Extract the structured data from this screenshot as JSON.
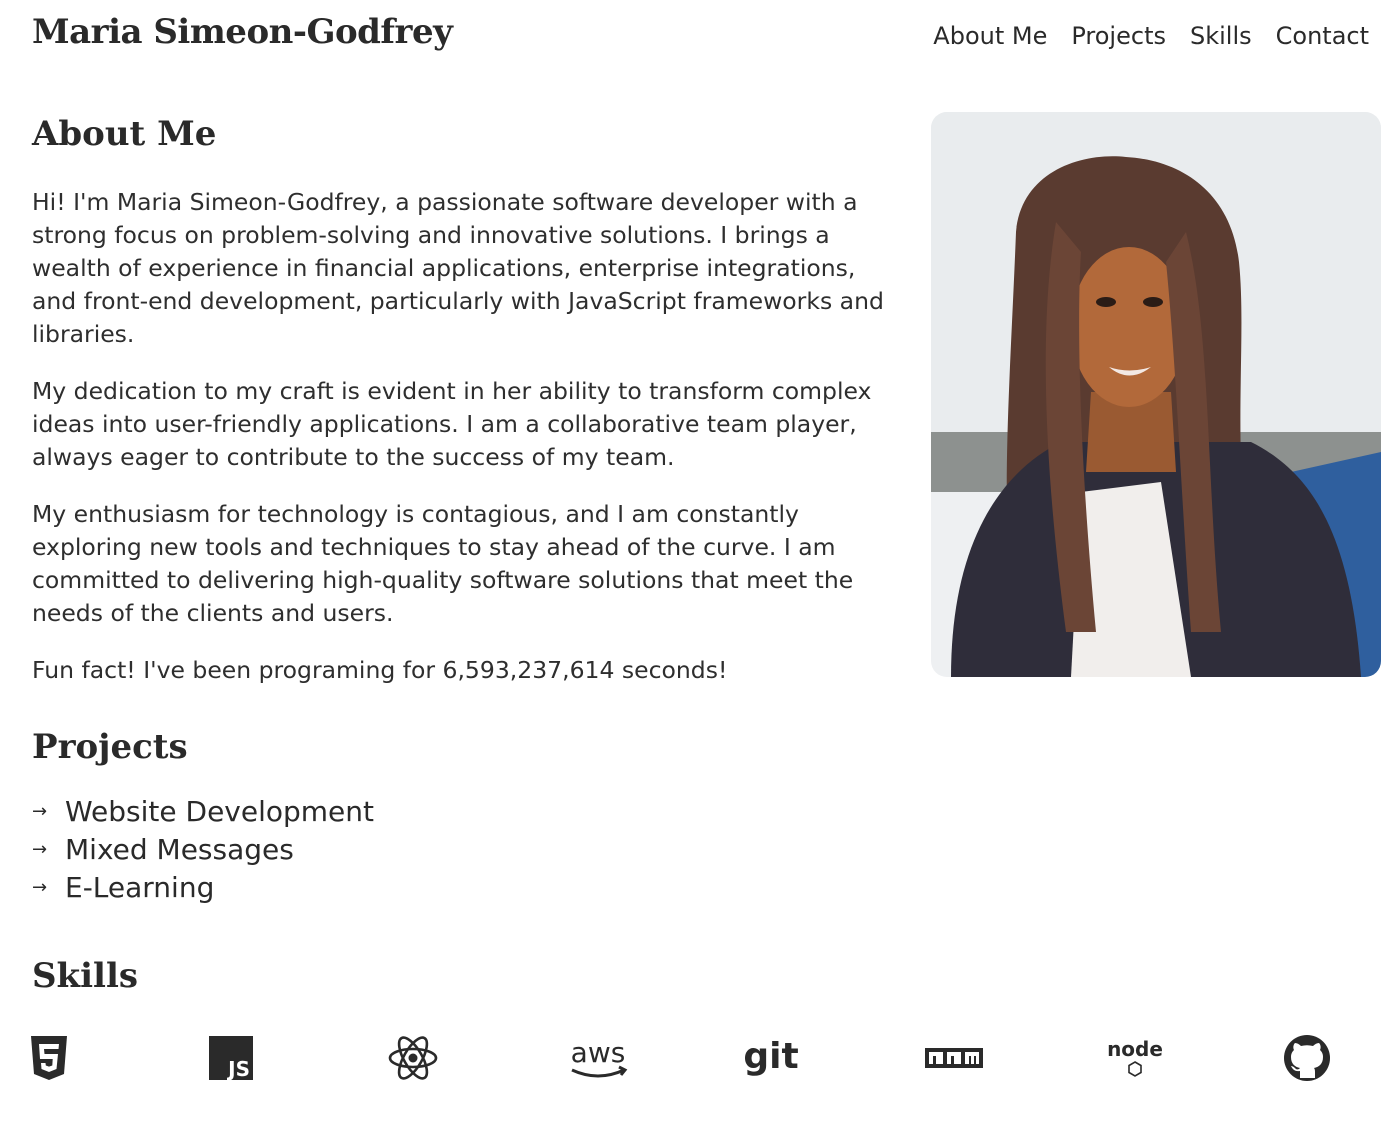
{
  "header": {
    "site_title": "Maria Simeon-Godfrey",
    "nav": [
      "About Me",
      "Projects",
      "Skills",
      "Contact"
    ]
  },
  "about": {
    "heading": "About Me",
    "paragraphs": [
      "Hi! I'm Maria Simeon-Godfrey, a passionate software developer with a strong focus on problem-solving and innovative solutions. I brings a wealth of experience in financial applications, enterprise integrations, and front-end development, particularly with JavaScript frameworks and libraries.",
      "My dedication to my craft is evident in her ability to transform complex ideas into user-friendly applications. I am a collaborative team player, always eager to contribute to the success of my team.",
      "My enthusiasm for technology is contagious, and I am constantly exploring new tools and techniques to stay ahead of the curve. I am committed to delivering high-quality software solutions that meet the needs of the clients and users.",
      "Fun fact! I've been programing for 6,593,237,614 seconds!"
    ]
  },
  "projects": {
    "heading": "Projects",
    "items": [
      "Website Development",
      "Mixed Messages",
      "E-Learning"
    ]
  },
  "skills": {
    "heading": "Skills",
    "icons": [
      "html5-icon",
      "javascript-icon",
      "react-icon",
      "aws-icon",
      "git-icon",
      "npm-icon",
      "nodejs-icon",
      "github-icon"
    ],
    "aws_label": "aws",
    "git_label": "git",
    "js_label": "JS",
    "npm_label": "npm",
    "node_label": "node"
  },
  "colors": {
    "text": "#2a2a2a",
    "background": "#ffffff"
  }
}
